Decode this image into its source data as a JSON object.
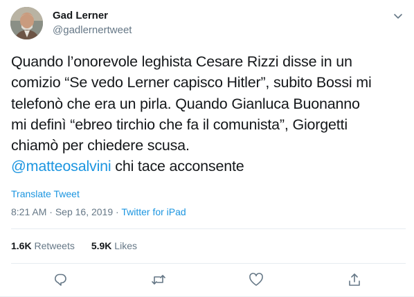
{
  "author": {
    "display_name": "Gad Lerner",
    "handle": "@gadlernertweet"
  },
  "tweet": {
    "text_lines": [
      "Quando l’onorevole leghista Cesare Rizzi disse in un",
      "comizio “Se vedo Lerner capisco Hitler”, subito Bossi mi",
      "telefonò che era un pirla. Quando Gianluca Buonanno",
      "mi definì “ebreo tirchio che fa il comunista”, Giorgetti",
      "chiamò per chiedere scusa."
    ],
    "mention": "@matteosalvini",
    "mention_tail": " chi tace acconsente",
    "translate_label": "Translate Tweet",
    "time": "8:21 AM",
    "sep1": " · ",
    "date": "Sep 16, 2019",
    "sep2": " · ",
    "source": "Twitter for iPad"
  },
  "stats": {
    "retweets_count": "1.6K",
    "retweets_label": "Retweets",
    "likes_count": "5.9K",
    "likes_label": "Likes"
  },
  "icons": {
    "caret": "chevron-down-icon",
    "reply": "reply-icon",
    "retweet": "retweet-icon",
    "like": "heart-icon",
    "share": "share-icon"
  },
  "colors": {
    "link": "#1b95e0",
    "secondary_text": "#657786",
    "primary_text": "#14171a",
    "border": "#e6ecf0"
  }
}
